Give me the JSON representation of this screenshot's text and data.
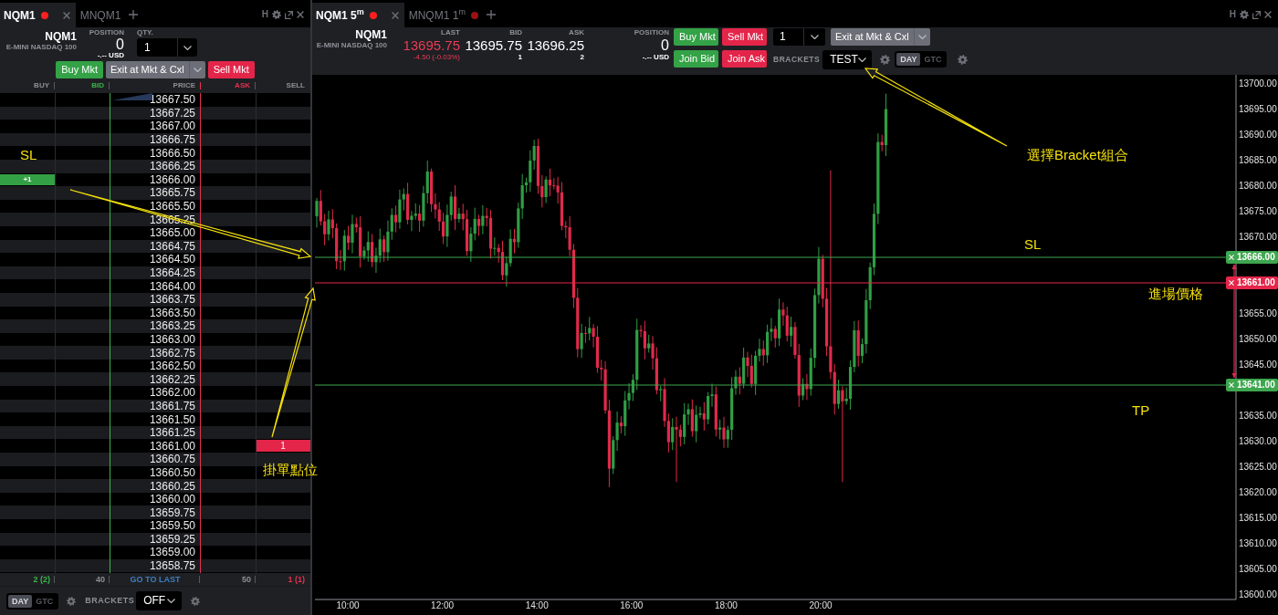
{
  "ladder_window": {
    "tabs": [
      {
        "label": "NQM1",
        "selected": true,
        "color": "#ff1f1f"
      },
      {
        "label": "MNQM1",
        "selected": false
      }
    ],
    "hotkey_button": "H",
    "instrument": {
      "symbol": "NQM1",
      "name": "E-MINI NASDAQ 100"
    },
    "position": {
      "label": "POSITION",
      "value": "0",
      "pnl": "-.-- USD"
    },
    "quantity": {
      "label": "QTY.",
      "value": "1"
    },
    "buttons": [
      {
        "label": "Buy Mkt",
        "kind": "buy"
      },
      {
        "label": "Exit at Mkt & Cxl",
        "kind": "exit"
      },
      {
        "label": "Sell Mkt",
        "kind": "sell"
      }
    ],
    "columns": [
      {
        "label": "BUY",
        "kind": "buy"
      },
      {
        "label": "BID",
        "kind": "bid"
      },
      {
        "label": "PRICE",
        "kind": "price"
      },
      {
        "label": "ASK",
        "kind": "ask"
      },
      {
        "label": "SELL",
        "kind": "sell"
      }
    ],
    "rows": [
      {
        "price": "13667.50"
      },
      {
        "price": "13667.25"
      },
      {
        "price": "13667.00"
      },
      {
        "price": "13666.75"
      },
      {
        "price": "13666.50"
      },
      {
        "price": "13666.25"
      },
      {
        "price": "13666.00",
        "buy_order": "+1"
      },
      {
        "price": "13665.75"
      },
      {
        "price": "13665.50"
      },
      {
        "price": "13665.25"
      },
      {
        "price": "13665.00"
      },
      {
        "price": "13664.75"
      },
      {
        "price": "13664.50"
      },
      {
        "price": "13664.25"
      },
      {
        "price": "13664.00"
      },
      {
        "price": "13663.75"
      },
      {
        "price": "13663.50"
      },
      {
        "price": "13663.25"
      },
      {
        "price": "13663.00"
      },
      {
        "price": "13662.75"
      },
      {
        "price": "13662.50"
      },
      {
        "price": "13662.25"
      },
      {
        "price": "13662.00"
      },
      {
        "price": "13661.75"
      },
      {
        "price": "13661.50"
      },
      {
        "price": "13661.25"
      },
      {
        "price": "13661.00",
        "sell_order": "1"
      },
      {
        "price": "13660.75"
      },
      {
        "price": "13660.50"
      },
      {
        "price": "13660.25"
      },
      {
        "price": "13660.00"
      },
      {
        "price": "13659.75"
      },
      {
        "price": "13659.50"
      },
      {
        "price": "13659.25"
      },
      {
        "price": "13659.00"
      },
      {
        "price": "13658.75"
      }
    ],
    "totals": [
      {
        "text": "2 (2)",
        "kind": "buy"
      },
      {
        "text": "40",
        "kind": "bid"
      },
      {
        "text": "GO TO LAST",
        "kind": "price"
      },
      {
        "text": "50",
        "kind": "ask"
      },
      {
        "text": "1 (1)",
        "kind": "sell"
      }
    ],
    "time_in_force": [
      {
        "label": "DAY",
        "selected": true
      },
      {
        "label": "GTC",
        "selected": false
      }
    ],
    "brackets": {
      "label": "BRACKETS",
      "value": "OFF"
    }
  },
  "chart_window": {
    "tabs": [
      {
        "label": "NQM1 5$^{m}$",
        "selected": true,
        "color": "#ff1f1f"
      },
      {
        "label": "MNQM1 1$^{m}$",
        "selected": false,
        "color": "#9b1212"
      }
    ],
    "hotkey_button": "H",
    "instrument": {
      "symbol": "NQM1",
      "name": "E-MINI NASDAQ 100"
    },
    "quotes": [
      {
        "label": "LAST",
        "value": "13695.75",
        "detail": "-4.50 (-0.03%)",
        "kind": "last"
      },
      {
        "label": "BID",
        "value": "13695.75",
        "detail": "1",
        "kind": "bid"
      },
      {
        "label": "ASK",
        "value": "13696.25",
        "detail": "2",
        "kind": "ask"
      }
    ],
    "position": {
      "label": "POSITION",
      "value": "0",
      "pnl": "-.-- USD"
    },
    "order_buttons": [
      {
        "label": "Buy Mkt",
        "kind": "buy"
      },
      {
        "label": "Sell Mkt",
        "kind": "sell"
      },
      {
        "label": "Join Bid",
        "kind": "buy"
      },
      {
        "label": "Join Ask",
        "kind": "sell"
      }
    ],
    "quantity": {
      "value": "1"
    },
    "exit_button": {
      "label": "Exit at Mkt & Cxl"
    },
    "brackets": {
      "label": "BRACKETS",
      "value": "TEST"
    },
    "time_in_force": [
      {
        "label": "DAY",
        "selected": true
      },
      {
        "label": "GTC",
        "selected": false
      }
    ],
    "chart": {
      "price_labels": [
        "13700.00",
        "13695.00",
        "13690.00",
        "13685.00",
        "13680.00",
        "13675.00",
        "13670.00",
        "13655.00",
        "13650.00",
        "13645.00",
        "13635.00",
        "13630.00",
        "13625.00",
        "13620.00",
        "13615.00",
        "13610.00",
        "13605.00",
        "13600.00"
      ],
      "time_labels": [
        "10:00",
        "12:00",
        "14:00",
        "16:00",
        "18:00",
        "20:00"
      ],
      "order_lines": [
        {
          "label": "13666.00",
          "color": "#3da64e"
        },
        {
          "label": "13661.00",
          "color": "#e5264a"
        },
        {
          "label": "13641.00",
          "color": "#3da64e"
        }
      ]
    }
  },
  "annotations": [
    {
      "text": "SL"
    },
    {
      "text": "掛單點位"
    },
    {
      "text": "選擇Bracket組合"
    },
    {
      "text": "SL"
    },
    {
      "text": "進場價格"
    },
    {
      "text": "TP"
    }
  ]
}
